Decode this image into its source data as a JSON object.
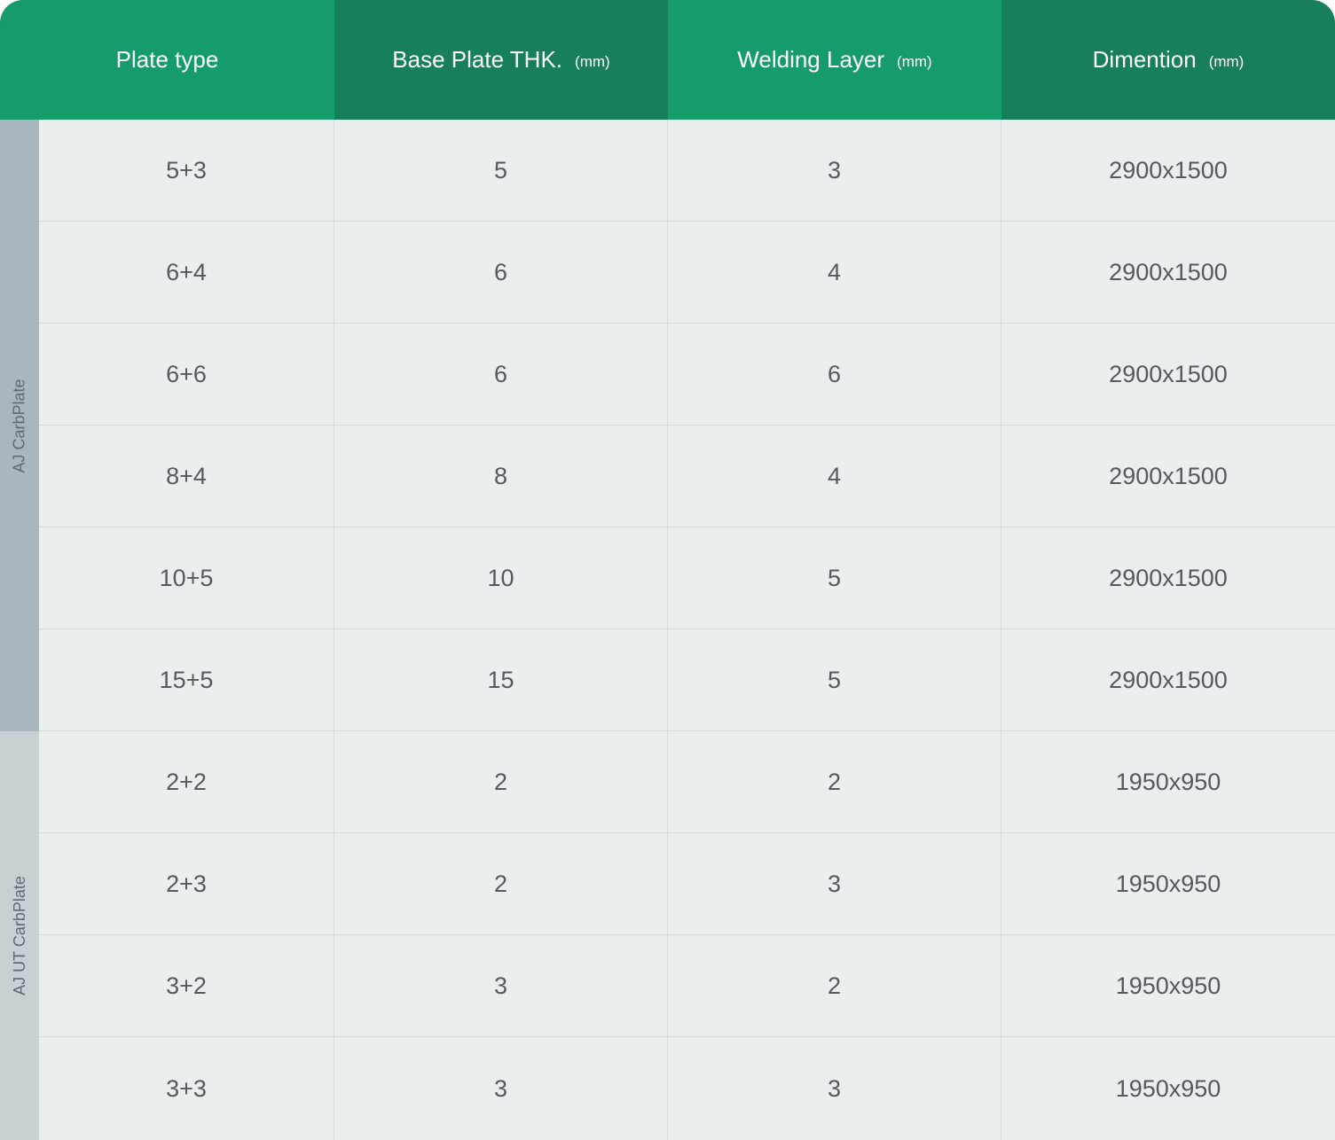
{
  "header": {
    "col1": {
      "label": "Plate type"
    },
    "col2": {
      "label": "Base Plate THK.",
      "unit": "(mm)"
    },
    "col3": {
      "label": "Welding Layer",
      "unit": "(mm)"
    },
    "col4": {
      "label": "Dimention",
      "unit": "(mm)"
    }
  },
  "groups": [
    {
      "label": "AJ CarbPlate"
    },
    {
      "label": "AJ UT CarbPlate"
    }
  ],
  "rows": [
    {
      "plate_type": "5+3",
      "base_thk": "5",
      "welding_layer": "3",
      "dimension": "2900x1500"
    },
    {
      "plate_type": "6+4",
      "base_thk": "6",
      "welding_layer": "4",
      "dimension": "2900x1500"
    },
    {
      "plate_type": "6+6",
      "base_thk": "6",
      "welding_layer": "6",
      "dimension": "2900x1500"
    },
    {
      "plate_type": "8+4",
      "base_thk": "8",
      "welding_layer": "4",
      "dimension": "2900x1500"
    },
    {
      "plate_type": "10+5",
      "base_thk": "10",
      "welding_layer": "5",
      "dimension": "2900x1500"
    },
    {
      "plate_type": "15+5",
      "base_thk": "15",
      "welding_layer": "5",
      "dimension": "2900x1500"
    },
    {
      "plate_type": "2+2",
      "base_thk": "2",
      "welding_layer": "2",
      "dimension": "1950x950"
    },
    {
      "plate_type": "2+3",
      "base_thk": "2",
      "welding_layer": "3",
      "dimension": "1950x950"
    },
    {
      "plate_type": "3+2",
      "base_thk": "3",
      "welding_layer": "2",
      "dimension": "1950x950"
    },
    {
      "plate_type": "3+3",
      "base_thk": "3",
      "welding_layer": "3",
      "dimension": "1950x950"
    }
  ],
  "colors": {
    "header_light": "#169c6b",
    "header_dark": "#177f5a",
    "group_a": "#aab6bd",
    "group_b": "#c7d1d4",
    "body_bg": "#e8efee"
  }
}
